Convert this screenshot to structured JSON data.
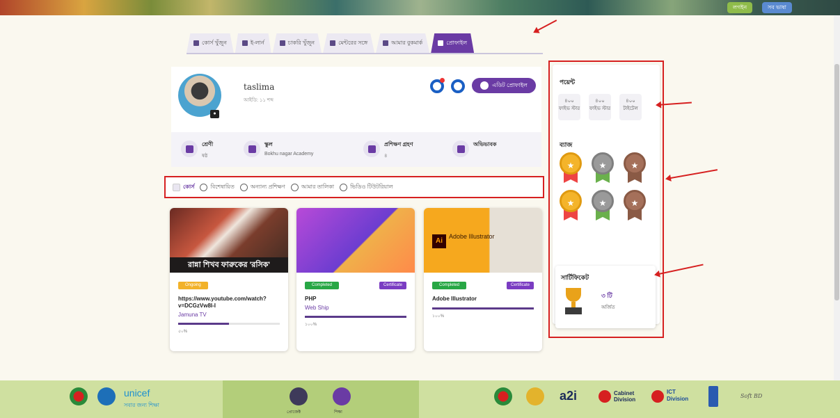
{
  "header": {
    "buttons": [
      "লগইন",
      "সব ভাষা"
    ]
  },
  "tabs": [
    {
      "label": "কোর্স খুঁজুন",
      "icon": "course-icon"
    },
    {
      "label": "ই-লার্ন",
      "icon": "learn-icon"
    },
    {
      "label": "চাকরি খুঁজুন",
      "icon": "job-icon"
    },
    {
      "label": "মেন্টরের সঙ্গে",
      "icon": "mentor-icon"
    },
    {
      "label": "আমার বুকমার্ক",
      "icon": "bookmark-icon"
    },
    {
      "label": "প্রোফাইল",
      "icon": "profile-icon"
    }
  ],
  "profile": {
    "name": "taslima",
    "id_label": "আইডি: ১১ শব্দ",
    "edit_button": "এডিট প্রোফাইল"
  },
  "info": [
    {
      "label": "শ্রেণী",
      "value": "ষষ্ঠ"
    },
    {
      "label": "স্কুল",
      "value": "Bokhu nagar Academy"
    },
    {
      "label": "প্রশিক্ষণ গ্রহণ",
      "value": "৪"
    },
    {
      "label": "অভিভাবক",
      "value": ""
    }
  ],
  "filters": [
    {
      "label": "কোর্স"
    },
    {
      "label": "বিশেষায়িত"
    },
    {
      "label": "অন্যান্য প্রশিক্ষণ"
    },
    {
      "label": "আমার তালিকা"
    },
    {
      "label": "ভিডিও টিউটরিয়াল"
    }
  ],
  "courses": [
    {
      "caption": "রান্না শিখব ফারুকের 'রসিক'",
      "badge": "Ongoing",
      "certificate": "",
      "title": "https://www.youtube.com/watch?v=DCGzVw8I-I",
      "source": "Jamuna TV",
      "progress": 0.5,
      "progress_label": "৫০%"
    },
    {
      "caption": "",
      "badge": "Completed",
      "certificate": "Certificate",
      "title": "PHP",
      "source": "Web Ship",
      "progress": 1.0,
      "progress_label": "১০০%"
    },
    {
      "caption": "Adobe Illustrator",
      "badge": "Completed",
      "certificate": "Certificate",
      "title": "Adobe Illustrator",
      "source": "",
      "progress": 1.0,
      "progress_label": "১০০%"
    }
  ],
  "sidebar": {
    "points_title": "পয়েন্ট",
    "points": [
      {
        "value": "৪০০",
        "label": "ফাইভ স্টার"
      },
      {
        "value": "৪০০",
        "label": "ফাইভ স্টার"
      },
      {
        "value": "৪০০",
        "label": "টাইটেল"
      }
    ],
    "badges_title": "ব্যাজ",
    "medals": [
      "gold",
      "silver",
      "bronze",
      "gold",
      "silver",
      "bronze"
    ],
    "certificates_title": "সার্টিফিকেট",
    "certificate_count": "৩ টি",
    "certificate_label": "অর্জিত"
  },
  "footer": {
    "left": "unicef",
    "left_sub": "সবার জন্য শিক্ষা",
    "mid": [
      "প্রোজেক্ট",
      "শিক্ষা"
    ],
    "right": [
      "a2i",
      "Cabinet Division",
      "ICT Division",
      "Soft BD"
    ]
  }
}
